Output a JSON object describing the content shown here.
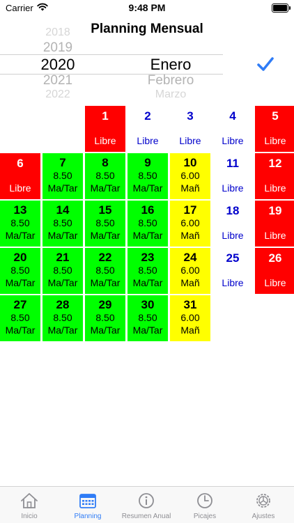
{
  "status_bar": {
    "carrier": "Carrier",
    "time": "9:48 PM"
  },
  "header": {
    "title": "Planning Mensual"
  },
  "picker": {
    "years": [
      "2018",
      "2019",
      "2020",
      "2021",
      "2022"
    ],
    "selected_year": "2020",
    "months": [
      "Enero",
      "Febrero",
      "Marzo"
    ],
    "selected_month": "Enero"
  },
  "confirm_icon": "checkmark-icon",
  "colors": {
    "red": "#ff0000",
    "green": "#00ff00",
    "yellow": "#ffff00",
    "blue_text": "#0000cc",
    "accent": "#2f7cf6"
  },
  "calendar": {
    "days": [
      {
        "day": "1",
        "shift": "Libre",
        "color": "red"
      },
      {
        "day": "2",
        "shift": "Libre",
        "color": "plain"
      },
      {
        "day": "3",
        "shift": "Libre",
        "color": "plain"
      },
      {
        "day": "4",
        "shift": "Libre",
        "color": "plain"
      },
      {
        "day": "5",
        "shift": "Libre",
        "color": "red"
      },
      {
        "day": "6",
        "shift": "Libre",
        "color": "red"
      },
      {
        "day": "7",
        "hours": "8.50",
        "shift": "Ma/Tar",
        "color": "green"
      },
      {
        "day": "8",
        "hours": "8.50",
        "shift": "Ma/Tar",
        "color": "green"
      },
      {
        "day": "9",
        "hours": "8.50",
        "shift": "Ma/Tar",
        "color": "green"
      },
      {
        "day": "10",
        "hours": "6.00",
        "shift": "Mañ",
        "color": "yellow"
      },
      {
        "day": "11",
        "shift": "Libre",
        "color": "plain"
      },
      {
        "day": "12",
        "shift": "Libre",
        "color": "red"
      },
      {
        "day": "13",
        "hours": "8.50",
        "shift": "Ma/Tar",
        "color": "green"
      },
      {
        "day": "14",
        "hours": "8.50",
        "shift": "Ma/Tar",
        "color": "green"
      },
      {
        "day": "15",
        "hours": "8.50",
        "shift": "Ma/Tar",
        "color": "green"
      },
      {
        "day": "16",
        "hours": "8.50",
        "shift": "Ma/Tar",
        "color": "green"
      },
      {
        "day": "17",
        "hours": "6.00",
        "shift": "Mañ",
        "color": "yellow"
      },
      {
        "day": "18",
        "shift": "Libre",
        "color": "plain"
      },
      {
        "day": "19",
        "shift": "Libre",
        "color": "red"
      },
      {
        "day": "20",
        "hours": "8.50",
        "shift": "Ma/Tar",
        "color": "green"
      },
      {
        "day": "21",
        "hours": "8.50",
        "shift": "Ma/Tar",
        "color": "green"
      },
      {
        "day": "22",
        "hours": "8.50",
        "shift": "Ma/Tar",
        "color": "green"
      },
      {
        "day": "23",
        "hours": "8.50",
        "shift": "Ma/Tar",
        "color": "green"
      },
      {
        "day": "24",
        "hours": "6.00",
        "shift": "Mañ",
        "color": "yellow"
      },
      {
        "day": "25",
        "shift": "Libre",
        "color": "plain"
      },
      {
        "day": "26",
        "shift": "Libre",
        "color": "red"
      },
      {
        "day": "27",
        "hours": "8.50",
        "shift": "Ma/Tar",
        "color": "green"
      },
      {
        "day": "28",
        "hours": "8.50",
        "shift": "Ma/Tar",
        "color": "green"
      },
      {
        "day": "29",
        "hours": "8.50",
        "shift": "Ma/Tar",
        "color": "green"
      },
      {
        "day": "30",
        "hours": "8.50",
        "shift": "Ma/Tar",
        "color": "green"
      },
      {
        "day": "31",
        "hours": "6.00",
        "shift": "Mañ",
        "color": "yellow"
      }
    ]
  },
  "tab_bar": {
    "tabs": [
      {
        "label": "Inicio",
        "icon": "house-icon",
        "active": false
      },
      {
        "label": "Planning",
        "icon": "calendar-icon",
        "active": true
      },
      {
        "label": "Resumen Anual",
        "icon": "info-icon",
        "active": false
      },
      {
        "label": "Picajes",
        "icon": "clock-icon",
        "active": false
      },
      {
        "label": "Ajustes",
        "icon": "gear-icon",
        "active": false
      }
    ]
  }
}
